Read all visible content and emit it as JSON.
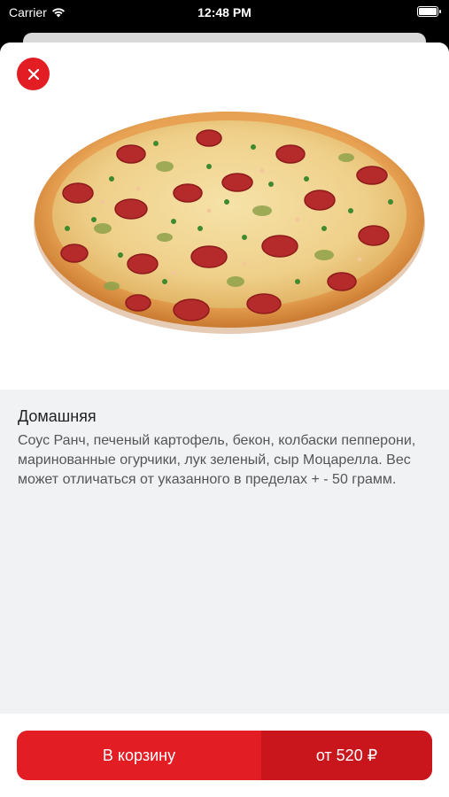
{
  "status_bar": {
    "carrier": "Carrier",
    "time": "12:48 PM"
  },
  "product": {
    "title": "Домашняя",
    "description": "Соус Ранч, печеный картофель, бекон, колбаски пепперони, маринованные огурчики, лук зеленый, сыр Моцарелла. Вес может отличаться от указанного в пределах + - 50 грамм.",
    "image_icon": "pizza-image"
  },
  "actions": {
    "close_icon": "close-icon",
    "cart_label": "В корзину",
    "price_label": "от 520 ₽"
  },
  "colors": {
    "accent": "#e21d24",
    "accent_dark": "#c9161d",
    "sheet_background": "#f1f2f4"
  }
}
